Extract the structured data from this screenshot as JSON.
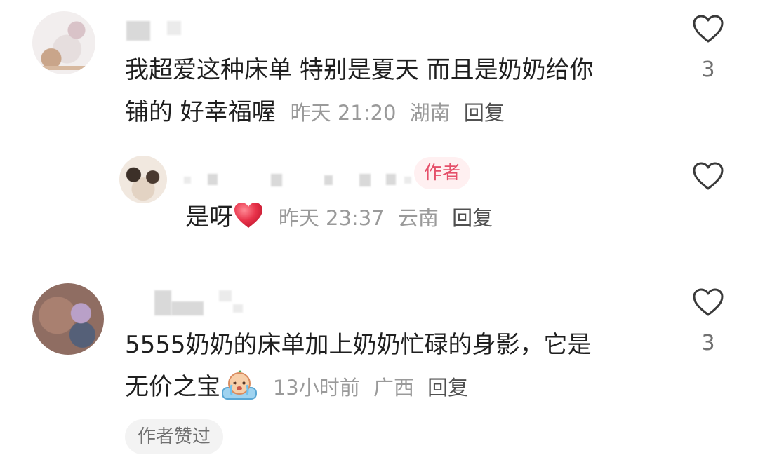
{
  "comments": [
    {
      "text_line1": "我超爱这种床单 特别是夏天 而且是奶奶给你",
      "text_line2": "铺的 好幸福喔",
      "time": "昨天 21:20",
      "location": "湖南",
      "reply_label": "回复",
      "like_count": "3"
    },
    {
      "text": "是呀",
      "emoji": "red-heart-icon",
      "time": "昨天 23:37",
      "location": "云南",
      "reply_label": "回复",
      "badge": "作者"
    },
    {
      "text_line1": "5555奶奶的床单加上奶奶忙碌的身影，它是",
      "text_line2": "无价之宝",
      "emoji": "crying-face-icon",
      "time": "13小时前",
      "location": "广西",
      "reply_label": "回复",
      "like_count": "3",
      "tag": "作者赞过"
    }
  ],
  "colors": {
    "text": "#1f1f1f",
    "meta": "#9a9a9a",
    "author_badge_text": "#e5506a",
    "author_badge_bg": "#fff0f1",
    "heart": "#e8334a"
  }
}
